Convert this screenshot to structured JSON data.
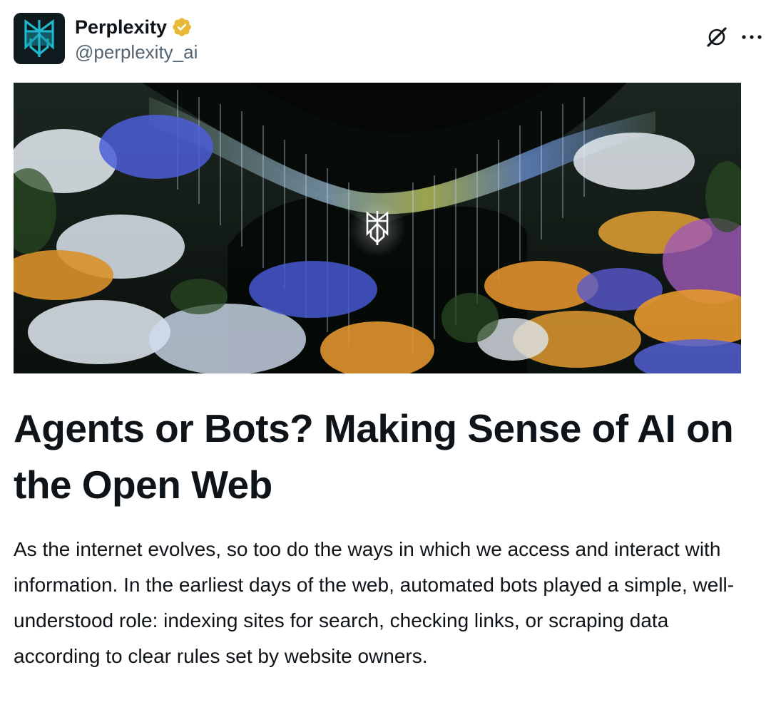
{
  "author": {
    "name": "Perplexity",
    "handle": "@perplexity_ai",
    "verified": true,
    "verified_badge_color": "#e8b839",
    "avatar_icon": "perplexity-logo-icon",
    "avatar_color": "#21b8cd"
  },
  "actions": {
    "grok_icon": "grok-slash-icon",
    "more_icon": "more-options-icon"
  },
  "hero": {
    "image_description_icon": "perplexity-logo-icon"
  },
  "article": {
    "title": "Agents or Bots? Making Sense of AI on the Open Web",
    "body": "As the internet evolves, so too do the ways in which we access and interact with information. In the earliest days of the web, automated bots played a simple, well-understood role: indexing sites for search, checking links, or scraping data according to clear rules set by website owners."
  }
}
